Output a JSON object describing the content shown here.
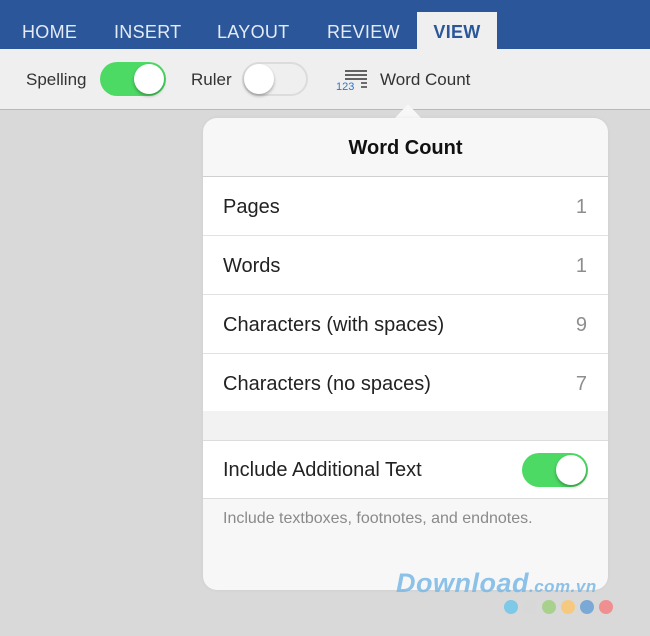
{
  "tabs": [
    {
      "label": "HOME"
    },
    {
      "label": "INSERT"
    },
    {
      "label": "LAYOUT"
    },
    {
      "label": "REVIEW"
    },
    {
      "label": "VIEW",
      "active": true
    }
  ],
  "toolbar": {
    "spelling_label": "Spelling",
    "spelling_on": true,
    "ruler_label": "Ruler",
    "ruler_on": false,
    "word_count_icon_text": "123",
    "word_count_label": "Word Count"
  },
  "popover": {
    "title": "Word Count",
    "rows": [
      {
        "label": "Pages",
        "value": "1"
      },
      {
        "label": "Words",
        "value": "1"
      },
      {
        "label": "Characters (with spaces)",
        "value": "9"
      },
      {
        "label": "Characters (no spaces)",
        "value": "7"
      }
    ],
    "include_label": "Include Additional Text",
    "include_on": true,
    "note": "Include textboxes, footnotes, and endnotes."
  },
  "watermark": {
    "text": "Download",
    "suffix": ".com.vn",
    "dot_colors": [
      "#7ec8e8",
      "#d8d8d8",
      "#a9d18e",
      "#f5c97f",
      "#7aa9d6",
      "#f08f8f"
    ]
  },
  "colors": {
    "ribbon": "#2b579a",
    "switch_on": "#4cd964"
  }
}
